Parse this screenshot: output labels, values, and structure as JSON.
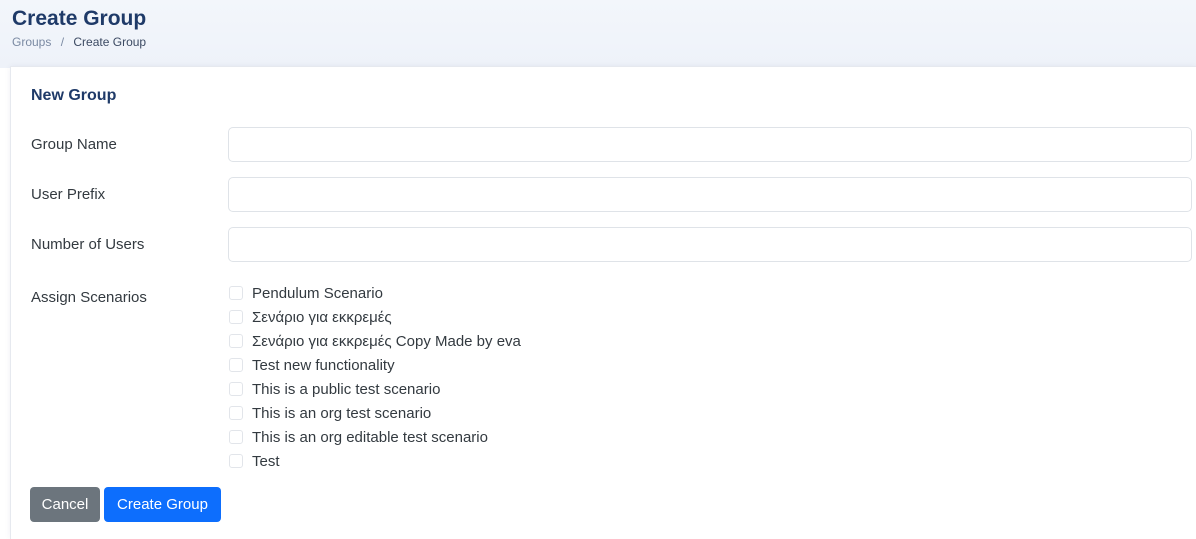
{
  "header": {
    "title": "Create Group",
    "breadcrumb": {
      "parent": "Groups",
      "separator": "/",
      "current": "Create Group"
    }
  },
  "form": {
    "card_title": "New Group",
    "group_name": {
      "label": "Group Name",
      "value": "",
      "placeholder": ""
    },
    "user_prefix": {
      "label": "User Prefix",
      "value": "",
      "placeholder": ""
    },
    "number_of_users": {
      "label": "Number of Users",
      "value": "",
      "placeholder": ""
    },
    "assign_scenarios": {
      "label": "Assign Scenarios",
      "options": [
        {
          "label": "Pendulum Scenario",
          "checked": false
        },
        {
          "label": "Σενάριο για εκκρεμές",
          "checked": false
        },
        {
          "label": "Σενάριο για εκκρεμές Copy Made by eva",
          "checked": false
        },
        {
          "label": "Test new functionality",
          "checked": false
        },
        {
          "label": "This is a public test scenario",
          "checked": false
        },
        {
          "label": "This is an org test scenario",
          "checked": false
        },
        {
          "label": "This is an org editable test scenario",
          "checked": false
        },
        {
          "label": "Test",
          "checked": false
        }
      ]
    },
    "buttons": {
      "cancel": "Cancel",
      "create": "Create Group"
    }
  },
  "colors": {
    "title": "#1f3a68",
    "primary": "#0d6efd",
    "secondary": "#6c757d",
    "header_bg": "#f3f6fb"
  }
}
